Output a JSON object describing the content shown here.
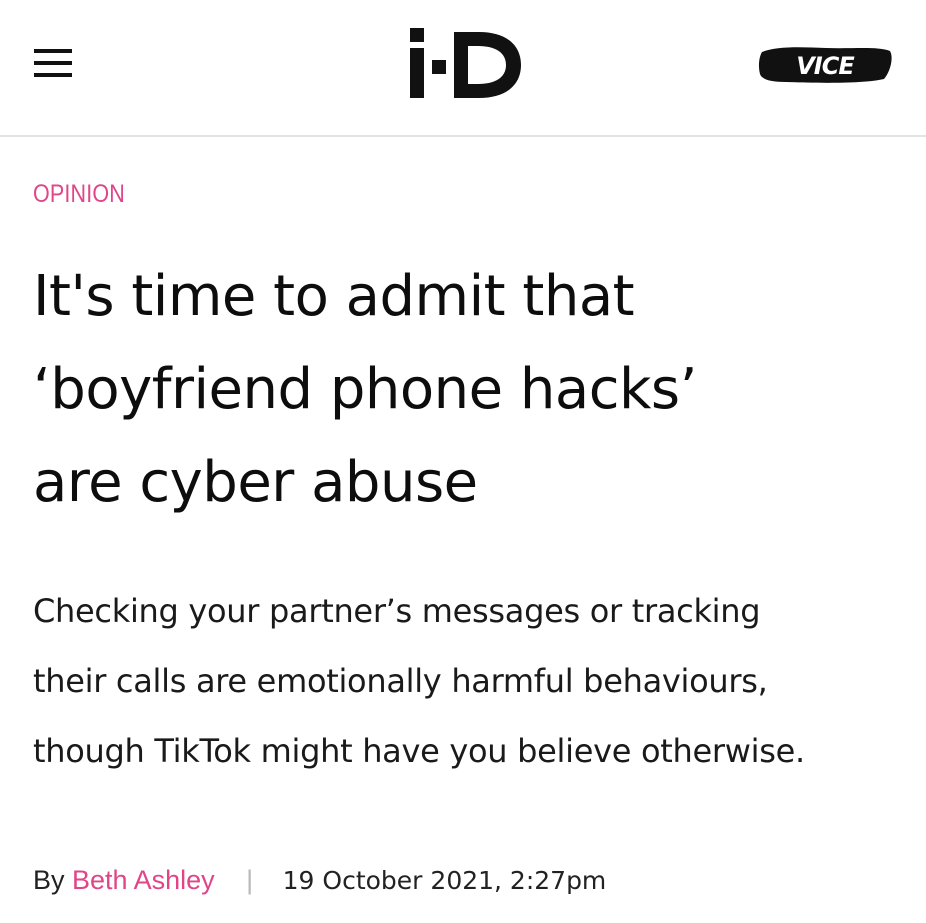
{
  "header": {
    "menu_icon": "hamburger-menu-icon",
    "logo_text": "i-D",
    "partner_logo_text": "VICE"
  },
  "article": {
    "category": "OPINION",
    "headline_lines": [
      "It's time to admit that",
      "‘boyfriend phone hacks’",
      "are cyber abuse"
    ],
    "dek_lines": [
      "Checking your partner’s messages or tracking",
      "their calls are emotionally harmful behaviours,",
      "though TikTok might have you believe otherwise."
    ],
    "byline": {
      "prefix": "By",
      "author": "Beth Ashley",
      "divider": "|",
      "date": "19 October 2021, 2:27pm"
    }
  },
  "colors": {
    "accent": "#e0458a",
    "text": "#111111",
    "divider": "#e3e3e3"
  }
}
